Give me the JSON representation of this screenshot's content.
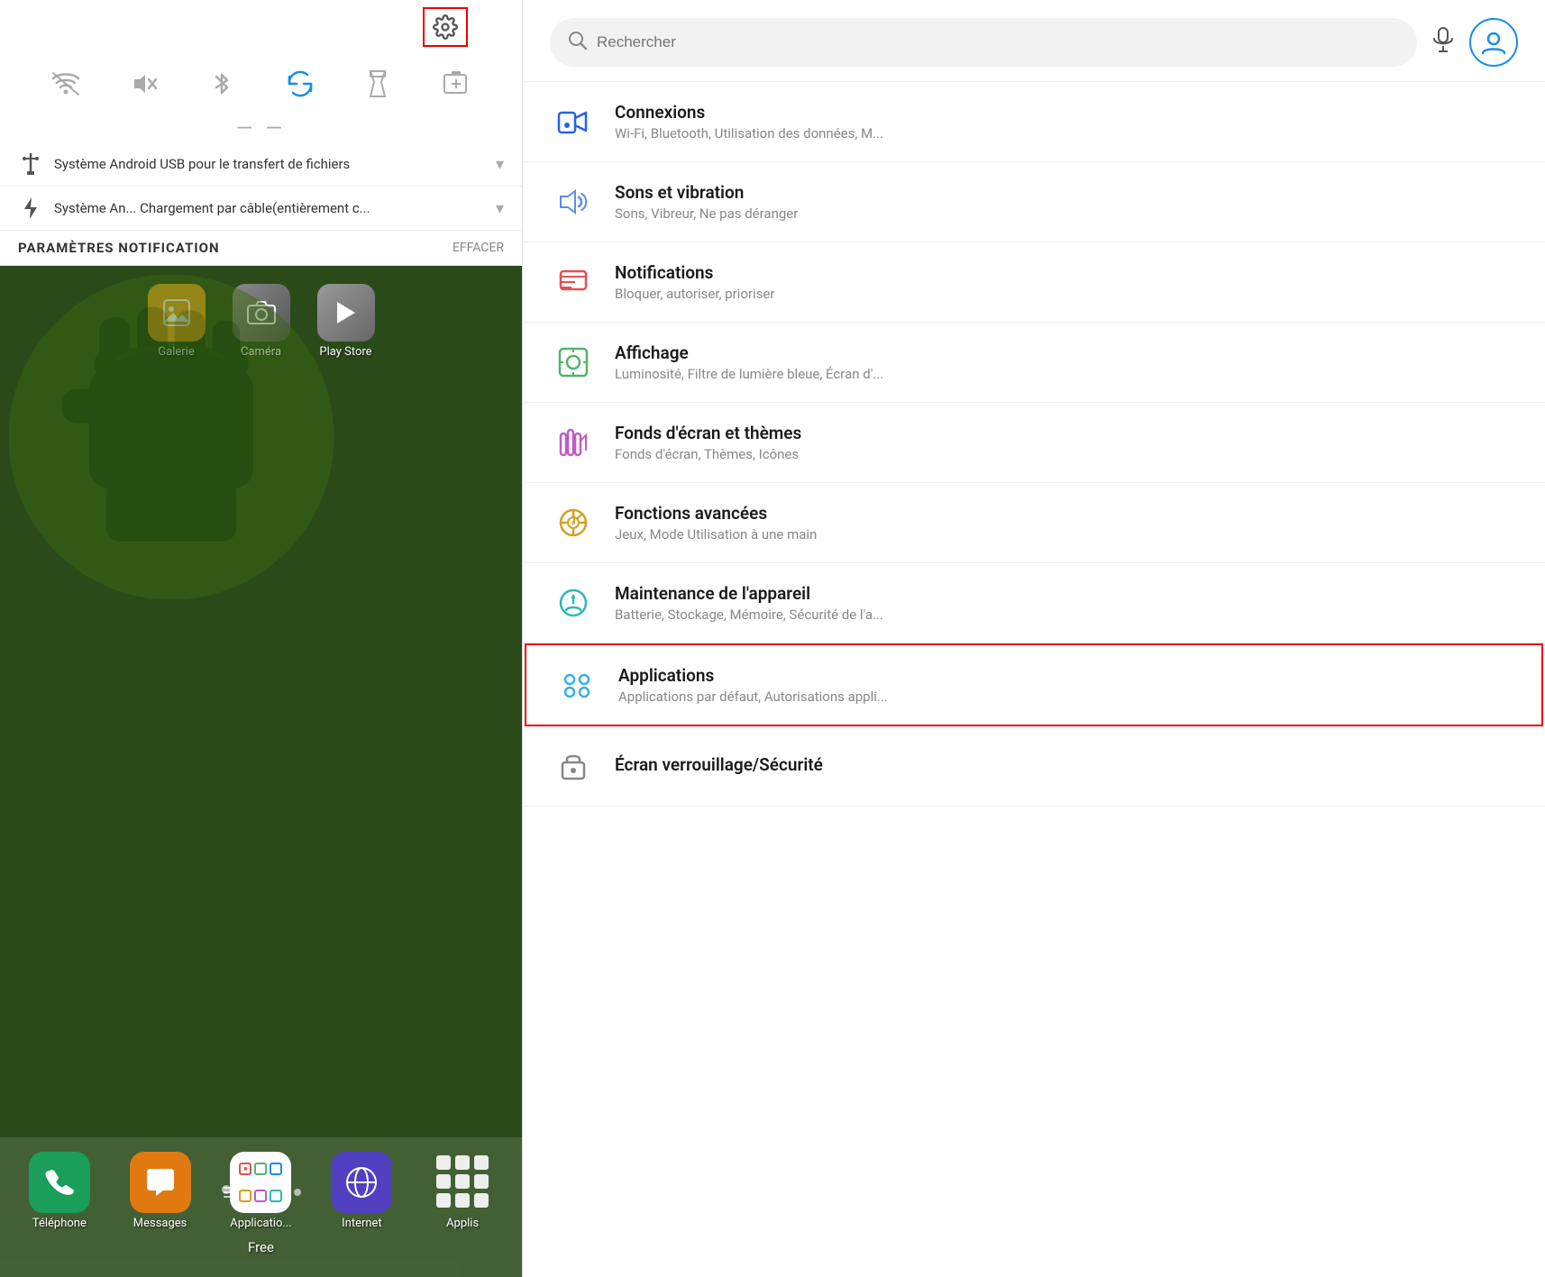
{
  "left": {
    "gear_button_label": "⚙",
    "quick_icons": [
      {
        "name": "wifi",
        "symbol": "⌇",
        "active": false,
        "label": "wifi"
      },
      {
        "name": "mute",
        "symbol": "🔇",
        "active": false,
        "label": "mute"
      },
      {
        "name": "bluetooth",
        "symbol": "⑂",
        "active": false,
        "label": "bluetooth"
      },
      {
        "name": "sync",
        "symbol": "↺",
        "active": true,
        "label": "sync"
      },
      {
        "name": "flashlight",
        "symbol": "⚡",
        "active": false,
        "label": "flashlight"
      },
      {
        "name": "battery",
        "symbol": "⊡",
        "active": false,
        "label": "battery"
      }
    ],
    "notifications": [
      {
        "icon": "⚡",
        "text": "Système Android   USB pour le transfert de fichiers",
        "arrow": "▾"
      },
      {
        "icon": "⚡",
        "text": "Système An...   Chargement par câble(entièrement c...",
        "arrow": "▾"
      }
    ],
    "notif_header": {
      "title": "PARAMÈTRES NOTIFICATION",
      "clear": "EFFACER"
    },
    "top_apps": [
      {
        "label": "Galerie",
        "color": "#e8a020",
        "icon": "🖼"
      },
      {
        "label": "Caméra",
        "color": "#888888",
        "icon": "📷"
      },
      {
        "label": "Play Store",
        "color": "#777777",
        "icon": "▶"
      }
    ],
    "dock_apps": [
      {
        "label": "Téléphone",
        "color": "#1a9e5a",
        "icon": "📞"
      },
      {
        "label": "Messages",
        "color": "#e07a10",
        "icon": "💬"
      },
      {
        "label": "Applicatio...",
        "color": "#ffffff",
        "icon": "⊞"
      },
      {
        "label": "Internet",
        "color": "#5040c0",
        "icon": "🪐"
      },
      {
        "label": "Applis",
        "color": "transparent",
        "icon": "⠿"
      }
    ],
    "free_label": "Free"
  },
  "right": {
    "search": {
      "placeholder": "Rechercher",
      "value": ""
    },
    "settings_items": [
      {
        "id": "connexions",
        "title": "Connexions",
        "subtitle": "Wi-Fi, Bluetooth, Utilisation des données, M...",
        "icon_color": "#2563eb",
        "highlighted": false
      },
      {
        "id": "sons",
        "title": "Sons et vibration",
        "subtitle": "Sons, Vibreur, Ne pas déranger",
        "icon_color": "#5b8dee",
        "highlighted": false
      },
      {
        "id": "notifications",
        "title": "Notifications",
        "subtitle": "Bloquer, autoriser, prioriser",
        "icon_color": "#e05252",
        "highlighted": false
      },
      {
        "id": "affichage",
        "title": "Affichage",
        "subtitle": "Luminosité, Filtre de lumière bleue, Écran d'...",
        "icon_color": "#52b26e",
        "highlighted": false
      },
      {
        "id": "fonds",
        "title": "Fonds d'écran et thèmes",
        "subtitle": "Fonds d'écran, Thèmes, Icônes",
        "icon_color": "#c05bc8",
        "highlighted": false
      },
      {
        "id": "fonctions",
        "title": "Fonctions avancées",
        "subtitle": "Jeux, Mode Utilisation à une main",
        "icon_color": "#d4a020",
        "highlighted": false
      },
      {
        "id": "maintenance",
        "title": "Maintenance de l'appareil",
        "subtitle": "Batterie, Stockage, Mémoire, Sécurité de l'a...",
        "icon_color": "#30b8b0",
        "highlighted": false
      },
      {
        "id": "applications",
        "title": "Applications",
        "subtitle": "Applications par défaut, Autorisations appli...",
        "icon_color": "#38b0e0",
        "highlighted": true
      },
      {
        "id": "ecran",
        "title": "Écran verrouillage/Sécurité",
        "subtitle": "",
        "icon_color": "#888",
        "highlighted": false
      }
    ]
  }
}
